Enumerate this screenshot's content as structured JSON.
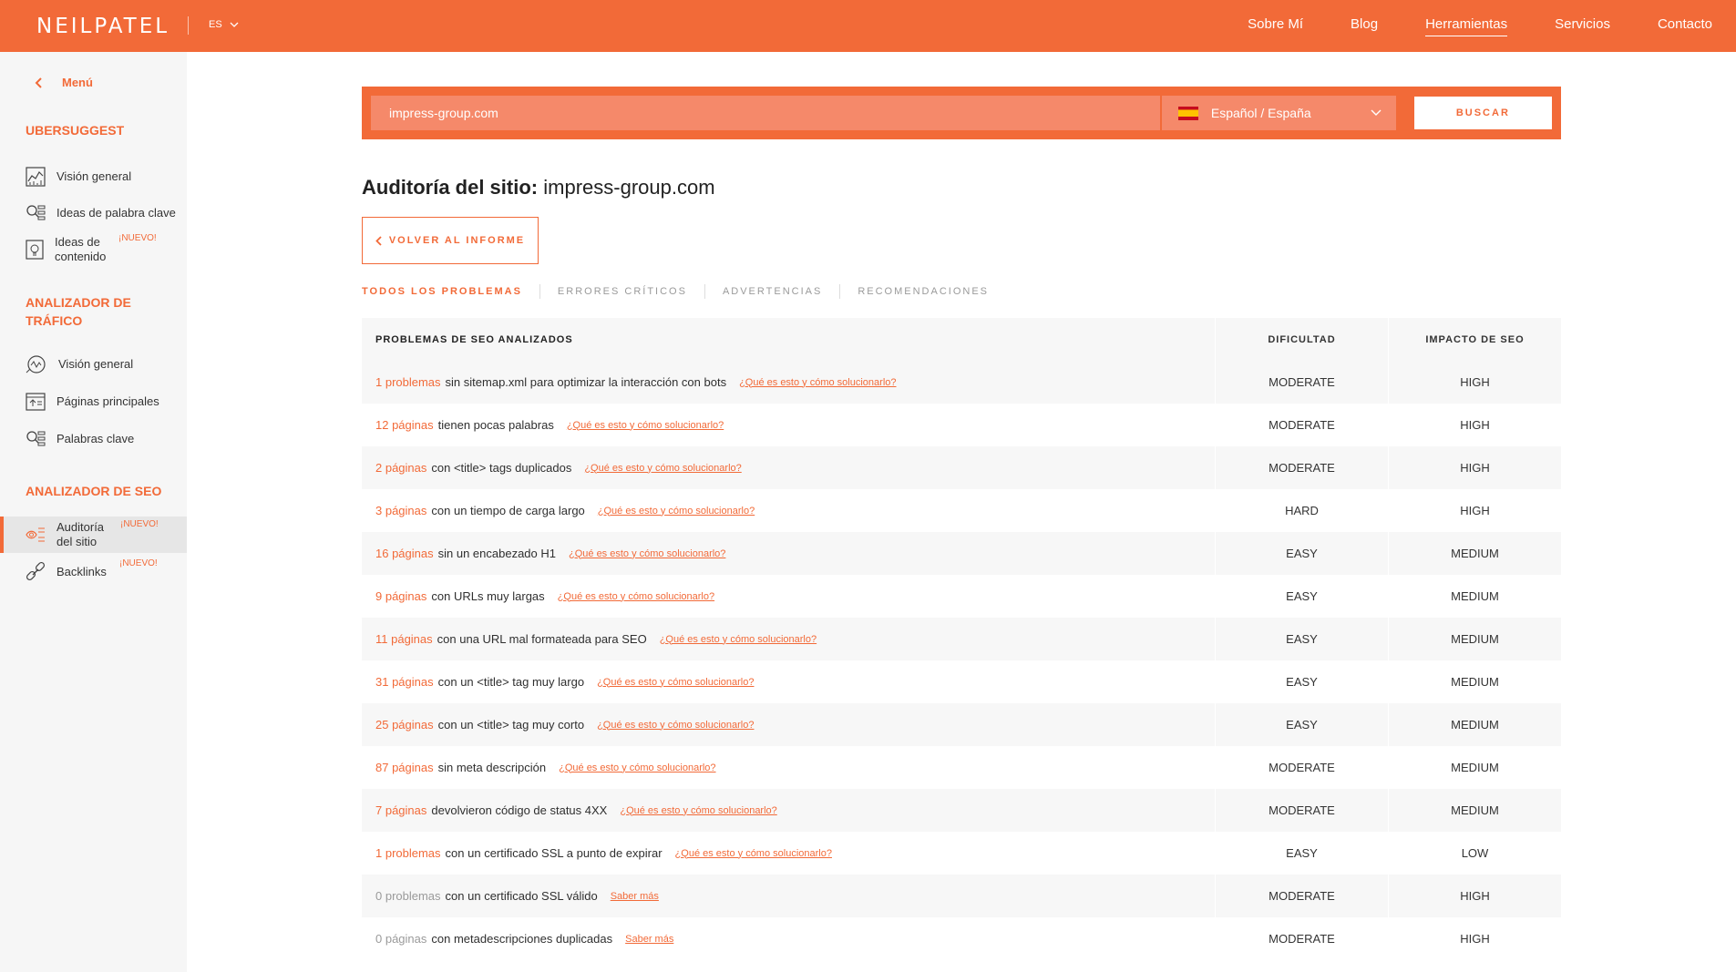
{
  "brand": {
    "logo": "NEILPATEL",
    "lang": "ES"
  },
  "nav": [
    "Sobre Mí",
    "Blog",
    "Herramientas",
    "Servicios",
    "Contacto"
  ],
  "sidebar": {
    "menu_label": "Menú",
    "section1": "UBERSUGGEST",
    "s1_items": [
      "Visión general",
      "Ideas de palabra clave",
      "Ideas de contenido"
    ],
    "section2": "ANALIZADOR DE TRÁFICO",
    "s2_items": [
      "Visión general",
      "Páginas principales",
      "Palabras clave"
    ],
    "section3": "ANALIZADOR DE SEO",
    "s3_items": [
      "Auditoría del sitio",
      "Backlinks"
    ],
    "badge": "¡NUEVO!"
  },
  "search": {
    "value": "impress-group.com",
    "locale": "Español / España",
    "button": "Buscar"
  },
  "title": {
    "prefix": "Auditoría del sitio:",
    "domain": "impress-group.com"
  },
  "back_button": "VOLVER AL INFORME",
  "tabs": [
    "TODOS LOS PROBLEMAS",
    "ERRORES CRÍTICOS",
    "ADVERTENCIAS",
    "RECOMENDACIONES"
  ],
  "table": {
    "headers": [
      "PROBLEMAS DE SEO ANALIZADOS",
      "DIFICULTAD",
      "IMPACTO DE SEO"
    ],
    "rows": [
      {
        "count": "1 problemas",
        "text": "sin sitemap.xml para optimizar la interacción con bots",
        "link": "¿Qué es esto y cómo solucionarlo?",
        "difficulty": "MODERATE",
        "impact": "HIGH"
      },
      {
        "count": "12 páginas",
        "text": "tienen pocas palabras",
        "link": "¿Qué es esto y cómo solucionarlo?",
        "difficulty": "MODERATE",
        "impact": "HIGH"
      },
      {
        "count": "2 páginas",
        "text": "con <title> tags duplicados",
        "link": "¿Qué es esto y cómo solucionarlo?",
        "difficulty": "MODERATE",
        "impact": "HIGH"
      },
      {
        "count": "3 páginas",
        "text": "con un tiempo de carga largo",
        "link": "¿Qué es esto y cómo solucionarlo?",
        "difficulty": "HARD",
        "impact": "HIGH"
      },
      {
        "count": "16 páginas",
        "text": "sin un encabezado H1",
        "link": "¿Qué es esto y cómo solucionarlo?",
        "difficulty": "EASY",
        "impact": "MEDIUM"
      },
      {
        "count": "9 páginas",
        "text": "con URLs muy largas",
        "link": "¿Qué es esto y cómo solucionarlo?",
        "difficulty": "EASY",
        "impact": "MEDIUM"
      },
      {
        "count": "11 páginas",
        "text": "con una URL mal formateada para SEO",
        "link": "¿Qué es esto y cómo solucionarlo?",
        "difficulty": "EASY",
        "impact": "MEDIUM"
      },
      {
        "count": "31 páginas",
        "text": "con un <title> tag muy largo",
        "link": "¿Qué es esto y cómo solucionarlo?",
        "difficulty": "EASY",
        "impact": "MEDIUM"
      },
      {
        "count": "25 páginas",
        "text": "con un <title> tag muy corto",
        "link": "¿Qué es esto y cómo solucionarlo?",
        "difficulty": "EASY",
        "impact": "MEDIUM"
      },
      {
        "count": "87 páginas",
        "text": "sin meta descripción",
        "link": "¿Qué es esto y cómo solucionarlo?",
        "difficulty": "MODERATE",
        "impact": "MEDIUM"
      },
      {
        "count": "7 páginas",
        "text": "devolvieron código de status 4XX",
        "link": "¿Qué es esto y cómo solucionarlo?",
        "difficulty": "MODERATE",
        "impact": "MEDIUM"
      },
      {
        "count": "1 problemas",
        "text": "con un certificado SSL a punto de expirar",
        "link": "¿Qué es esto y cómo solucionarlo?",
        "difficulty": "EASY",
        "impact": "LOW"
      },
      {
        "count": "0 problemas",
        "text": "con un certificado SSL válido",
        "link": "Saber más",
        "difficulty": "MODERATE",
        "impact": "HIGH"
      },
      {
        "count": "0 páginas",
        "text": "con metadescripciones duplicadas",
        "link": "Saber más",
        "difficulty": "MODERATE",
        "impact": "HIGH"
      }
    ]
  },
  "colors": {
    "accent": "#f26a38",
    "sidebar_bg": "#f6f6f6",
    "row_alt": "#f7f7f7"
  }
}
